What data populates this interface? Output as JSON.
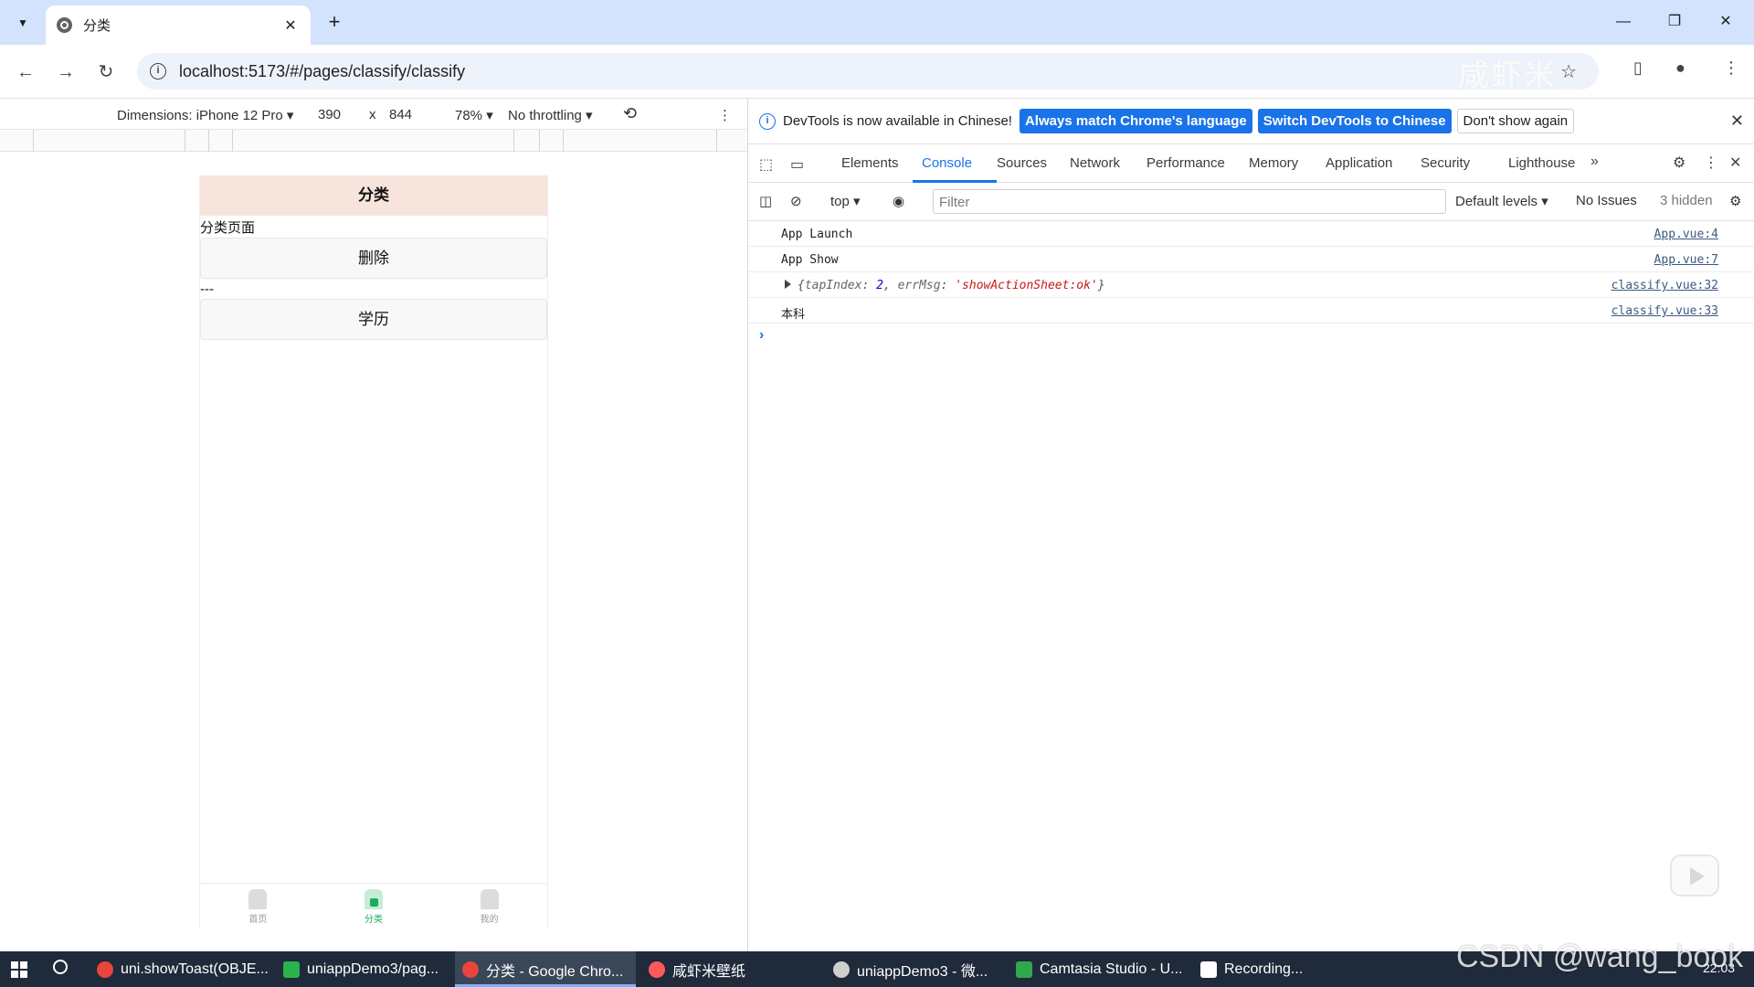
{
  "browser": {
    "tab_title": "分类",
    "tab_close": "✕",
    "new_tab": "+",
    "url": "localhost:5173/#/pages/classify/classify",
    "window_controls": {
      "minimize": "—",
      "maximize": "❐",
      "close": "✕"
    },
    "watermark": "咸虾米_"
  },
  "device_toolbar": {
    "dimensions_label": "Dimensions: iPhone 12 Pro ▾",
    "width": "390",
    "times": "x",
    "height": "844",
    "zoom": "78% ▾",
    "throttling": "No throttling ▾",
    "more": "⋮"
  },
  "phone": {
    "nav_title": "分类",
    "page_text": "分类页面",
    "delete_button": "删除",
    "separator": "---",
    "education_button": "学历",
    "tabbar": [
      {
        "label": "首页",
        "active": false
      },
      {
        "label": "分类",
        "active": true
      },
      {
        "label": "我的",
        "active": false
      }
    ]
  },
  "devtools": {
    "info_text": "DevTools is now available in Chinese!",
    "btn_match_language": "Always match Chrome's language",
    "btn_switch_chinese": "Switch DevTools to Chinese",
    "btn_dont_show": "Don't show again",
    "tabs": [
      "Elements",
      "Console",
      "Sources",
      "Network",
      "Performance",
      "Memory",
      "Application",
      "Security",
      "Lighthouse"
    ],
    "active_tab": "Console",
    "context": "top ▾",
    "filter_placeholder": "Filter",
    "default_levels": "Default levels ▾",
    "no_issues": "No Issues",
    "hidden": "3 hidden",
    "logs": [
      {
        "message": "App Launch",
        "source": "App.vue:4"
      },
      {
        "message": "App Show",
        "source": "App.vue:7"
      },
      {
        "message_open": "{",
        "key1": "tapIndex",
        "val1": "2",
        "key2": "errMsg",
        "val2": "'showActionSheet:ok'",
        "message_close": "}",
        "source": "classify.vue:32"
      },
      {
        "message": "本科",
        "source": "classify.vue:33"
      }
    ],
    "prompt": "›"
  },
  "taskbar": {
    "items": [
      {
        "label": "uni.showToast(OBJE...",
        "color": "#e8453c"
      },
      {
        "label": "uniappDemo3/pag...",
        "color": "#2bb24c"
      },
      {
        "label": "分类 - Google Chro...",
        "color": "#e8453c"
      },
      {
        "label": "咸虾米壁纸",
        "color": "#ff5a5a"
      },
      {
        "label": "uniappDemo3 - 微...",
        "color": "#cfcfcf"
      },
      {
        "label": "Camtasia Studio - U...",
        "color": "#2fa84f"
      },
      {
        "label": "Recording...",
        "color": "#ffffff"
      }
    ],
    "time": "22:03",
    "watermark": "CSDN @wang_book"
  }
}
